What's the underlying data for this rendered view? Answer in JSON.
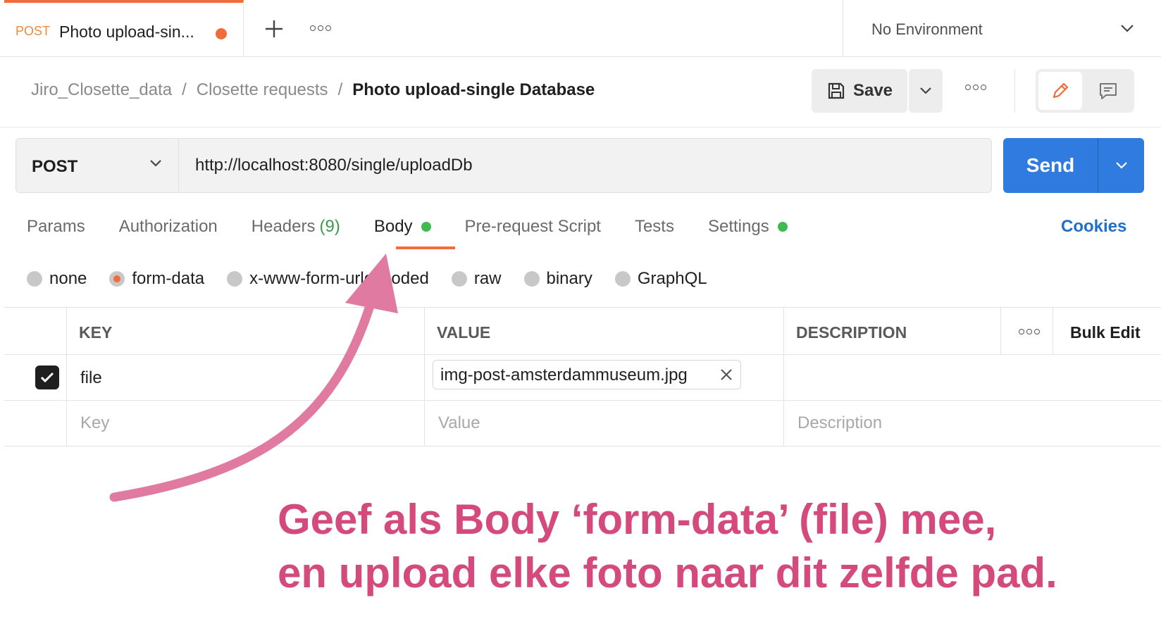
{
  "tab": {
    "method": "POST",
    "title": "Photo upload-sin...",
    "unsaved_indicator_color": "#f26b3a"
  },
  "icons": {
    "new_tab": "plus-icon",
    "more": "more-horizontal-icon",
    "dropdown": "chevron-down-icon",
    "save": "save-disk-icon",
    "edit": "pencil-icon",
    "comments": "comment-icon",
    "checkbox": "check-icon",
    "remove": "close-icon"
  },
  "environment": {
    "selected": "No Environment"
  },
  "breadcrumb": {
    "workspace": "Jiro_Closette_data",
    "collection": "Closette requests",
    "request": "Photo upload-single Database",
    "separator": "/"
  },
  "toolbar": {
    "save_label": "Save"
  },
  "request": {
    "method": "POST",
    "url": "http://localhost:8080/single/uploadDb",
    "send_label": "Send"
  },
  "request_tabs": [
    {
      "label": "Params",
      "count": "",
      "dot": false
    },
    {
      "label": "Authorization",
      "count": "",
      "dot": false
    },
    {
      "label": "Headers",
      "count": "(9)",
      "dot": false
    },
    {
      "label": "Body",
      "count": "",
      "dot": true,
      "active": true
    },
    {
      "label": "Pre-request Script",
      "count": "",
      "dot": false
    },
    {
      "label": "Tests",
      "count": "",
      "dot": false
    },
    {
      "label": "Settings",
      "count": "",
      "dot": true
    }
  ],
  "cookies_label": "Cookies",
  "body_types": [
    {
      "label": "none",
      "selected": false
    },
    {
      "label": "form-data",
      "selected": true
    },
    {
      "label": "x-www-form-urlencoded",
      "selected": false
    },
    {
      "label": "raw",
      "selected": false
    },
    {
      "label": "binary",
      "selected": false
    },
    {
      "label": "GraphQL",
      "selected": false
    }
  ],
  "table": {
    "headers": {
      "key": "KEY",
      "value": "VALUE",
      "description": "DESCRIPTION",
      "bulk_edit": "Bulk Edit"
    },
    "rows": [
      {
        "checked": true,
        "key": "file",
        "value": "img-post-amsterdammuseum.jpg",
        "description": ""
      }
    ],
    "placeholders": {
      "key": "Key",
      "value": "Value",
      "description": "Description"
    }
  },
  "annotation": {
    "line1": "Geef als Body ‘form-data’ (file) mee,",
    "line2": "en upload elke foto naar dit zelfde pad.",
    "color": "#d44a7c",
    "arrow_color": "#e07aa0"
  },
  "colors": {
    "accent_orange": "#f26b3a",
    "send_blue": "#2f7be0",
    "link_blue": "#1f6fcc",
    "status_green": "#3fb950"
  }
}
